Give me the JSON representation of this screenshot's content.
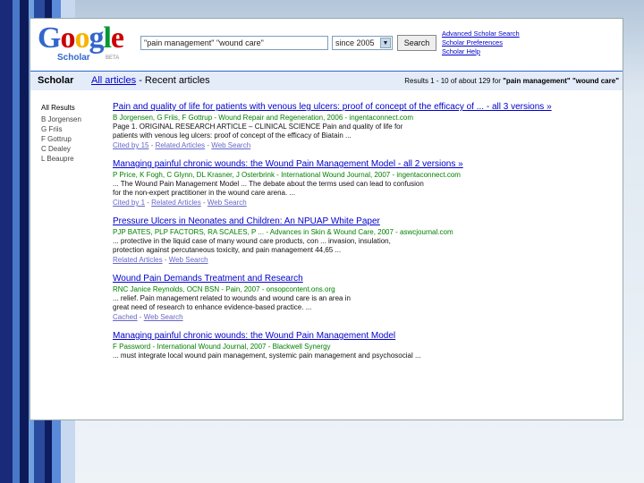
{
  "colors": {
    "link": "#0000cc",
    "green": "#008000",
    "bar": "#e5ecf9",
    "accent": "#3366cc"
  },
  "logo": {
    "letters": [
      "G",
      "o",
      "o",
      "g",
      "l",
      "e"
    ],
    "colors": [
      "#3366cc",
      "#cc0000",
      "#f5b400",
      "#3366cc",
      "#009933",
      "#cc0000"
    ],
    "sub": "Scholar",
    "beta": "BETA"
  },
  "search": {
    "query": "\"pain management\" \"wound care\"",
    "since": "since 2005",
    "button": "Search"
  },
  "toplinks": [
    "Advanced Scholar Search",
    "Scholar Preferences",
    "Scholar Help"
  ],
  "bar": {
    "scholar": "Scholar",
    "all_articles": "All articles",
    "recent": "- Recent articles",
    "stats_prefix": "Results 1 - 10 of about 129 for",
    "stats_terms": "\"pain management\" \"wound care\""
  },
  "sidebar": {
    "head": "All Results",
    "authors": [
      "B Jorgensen",
      "G Friis",
      "F Gottrup",
      "C Dealey",
      "L Beaupre"
    ]
  },
  "results": [
    {
      "title": "Pain and quality of life for patients with venous leg ulcers: proof of concept of the efficacy of ...",
      "versions": "- all 3 versions »",
      "meta": "B Jorgensen, G Friis, F Gottrup - Wound Repair and Regeneration, 2006 - ingentaconnect.com",
      "snippet": [
        "Page 1. ORIGINAL RESEARCH ARTICLE – CLINICAL SCIENCE Pain and quality of life for",
        "patients with venous leg ulcers: proof of concept of the efficacy of Biatain ..."
      ],
      "links": [
        "Cited by 15",
        "Related Articles",
        "Web Search"
      ]
    },
    {
      "title": "Managing painful chronic wounds: the Wound Pain Management Model",
      "versions": "- all 2 versions »",
      "meta": "P Price, K Fogh, C Glynn, DL Krasner, J Osterbrink - International Wound Journal, 2007 - ingentaconnect.com",
      "snippet": [
        "... The Wound Pain Management Model ... The debate about the terms used can lead to confusion",
        "for the non-expert practitioner in the wound care arena. ..."
      ],
      "links": [
        "Cited by 1",
        "Related Articles",
        "Web Search"
      ]
    },
    {
      "title": "Pressure Ulcers in Neonates and Children: An NPUAP White Paper",
      "versions": "",
      "meta": "PJP BATES, PLP FACTORS, RA SCALES, P ... - Advances in Skin & Wound Care, 2007 - aswcjournal.com",
      "snippet": [
        "... protective in the liquid case of many wound care products, con ... invasion, insulation,",
        "protection against percutaneous toxicity, and pain management 44,65 ..."
      ],
      "links": [
        "Related Articles",
        "Web Search"
      ]
    },
    {
      "title": "Wound Pain Demands Treatment and Research",
      "versions": "",
      "meta": "RNC Janice Reynolds, OCN BSN - Pain, 2007 - onsopcontent.ons.org",
      "snippet": [
        "... relief. Pain management related to wounds and wound care is an area in",
        "great need of research to enhance evidence-based practice. ..."
      ],
      "links": [
        "Cached",
        "Web Search"
      ]
    },
    {
      "title": "Managing painful chronic wounds: the Wound Pain Management Model",
      "versions": "",
      "meta": "F Password - International Wound Journal, 2007 - Blackwell Synergy",
      "snippet": [
        "... must integrate local wound pain management, systemic pain management and psychosocial ..."
      ],
      "links": []
    }
  ]
}
